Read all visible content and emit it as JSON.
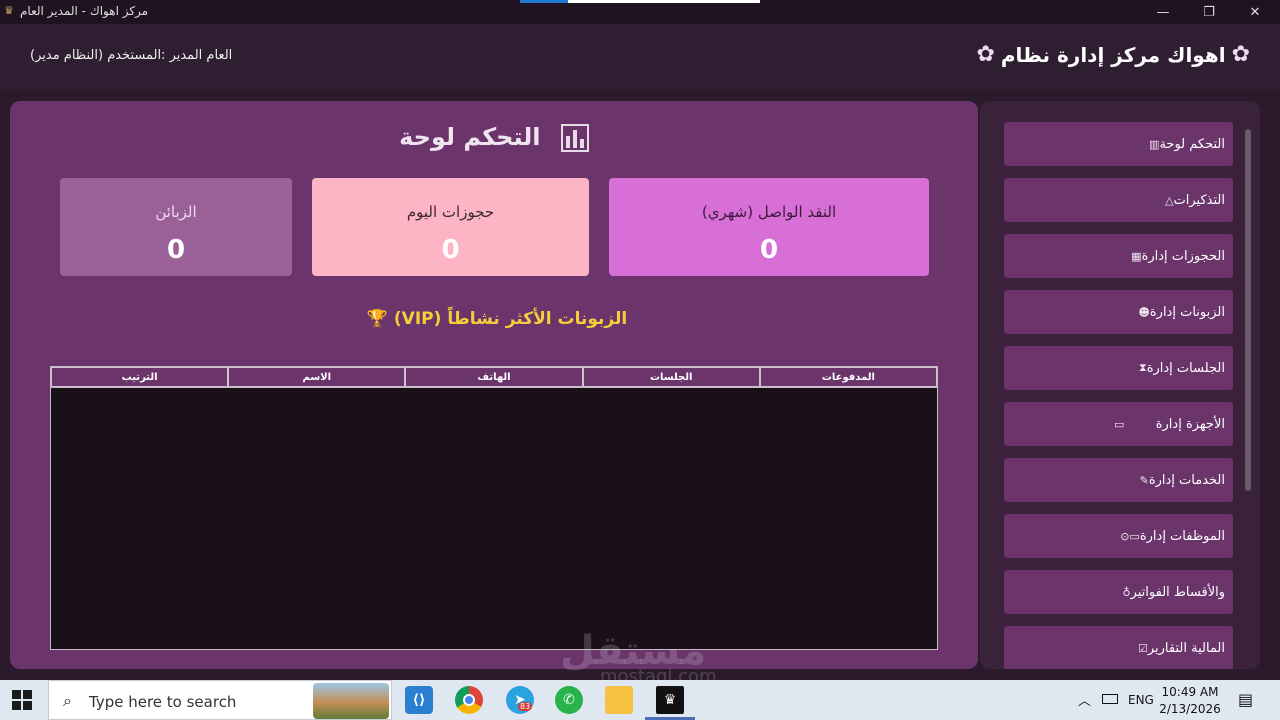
{
  "window": {
    "title": "مركز اهواك - المدير العام",
    "minimize": "—",
    "maximize": "❐",
    "close": "✕"
  },
  "header": {
    "brand": "اهواك مركز إدارة نظام",
    "user": "(النظام مدير) العام المدير :المستخدم"
  },
  "dashboard": {
    "title": "التحكم لوحة",
    "cards": {
      "customers": {
        "label": "الزبائن",
        "value": "0"
      },
      "bookings": {
        "label": "حجوزات اليوم",
        "value": "0"
      },
      "cash": {
        "label": "النقد الواصل (شهري)",
        "value": "0"
      }
    },
    "vip_title": "(VIP) الزبونات الأكثر نشاطاً",
    "table_headers": [
      "الترتيب",
      "الاسم",
      "الهاتف",
      "الجلسات",
      "المدفوعات"
    ]
  },
  "sidebar": {
    "items": [
      {
        "label": "التحكم لوحة",
        "icon": "chart-icon"
      },
      {
        "label": "التذكيرات",
        "icon": "bell-icon"
      },
      {
        "label": "الحجوزات إدارة",
        "icon": "calendar-icon"
      },
      {
        "label": "الزبونات إدارة",
        "icon": "users-icon"
      },
      {
        "label": "الجلسات إدارة",
        "icon": "hourglass-icon"
      },
      {
        "label": "الأجهزة إدارة",
        "icon": "monitor-icon"
      },
      {
        "label": "الخدمات إدارة",
        "icon": "pencil-icon"
      },
      {
        "label": "الموظفات إدارة",
        "icon": "briefcase-icon"
      },
      {
        "label": "والأقساط الفواتير",
        "icon": "moneybag-icon"
      },
      {
        "label": "المالية التقارير",
        "icon": "report-icon"
      }
    ]
  },
  "taskbar": {
    "search_placeholder": "Type here to search",
    "telegram_badge": "83",
    "language": "ENG",
    "time": "10:49 AM",
    "date": "2/13/2026"
  },
  "watermark": {
    "arabic": "مستقل",
    "latin": "mostaql.com"
  }
}
